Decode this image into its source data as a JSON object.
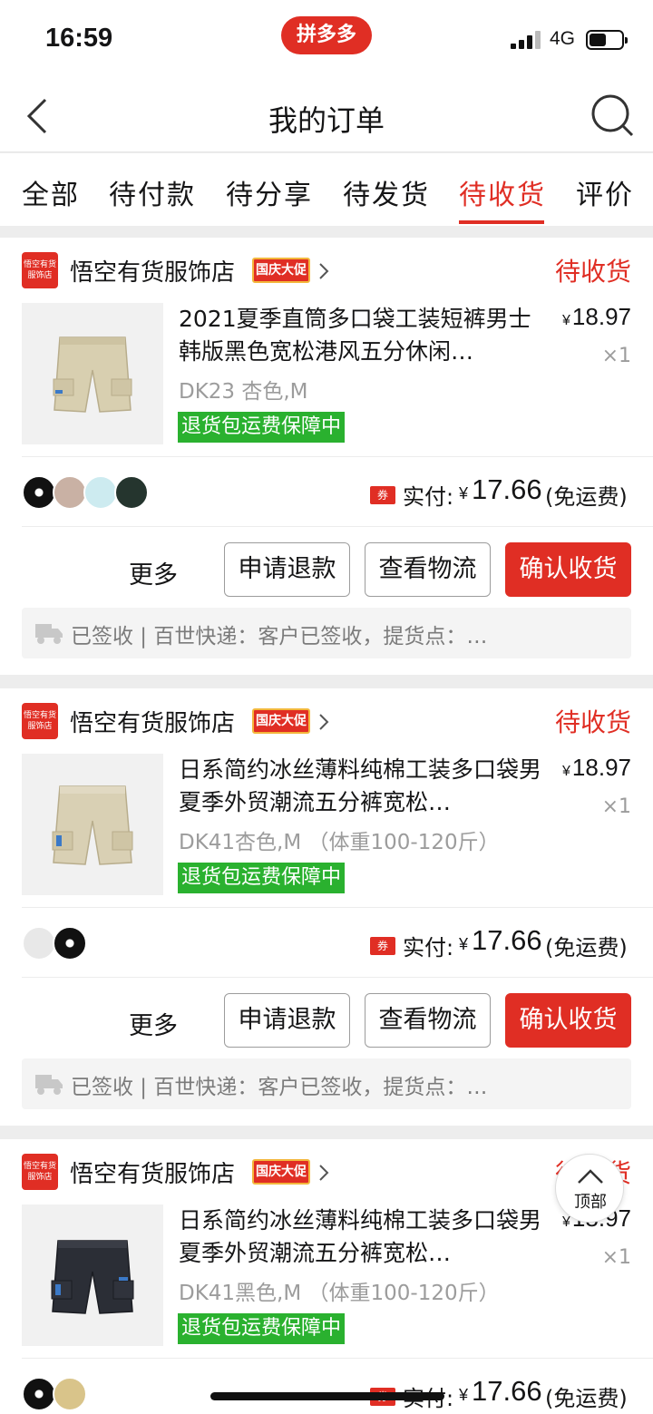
{
  "status_bar": {
    "time": "16:59",
    "app_logo": "拼多多",
    "network": "4G"
  },
  "nav": {
    "title": "我的订单"
  },
  "tabs": [
    {
      "label": "全部"
    },
    {
      "label": "待付款"
    },
    {
      "label": "待分享"
    },
    {
      "label": "待发货"
    },
    {
      "label": "待收货",
      "active": true
    },
    {
      "label": "评价"
    }
  ],
  "theme": {
    "accent": "#e02e24",
    "guarantee": "#2ab12f"
  },
  "orders": [
    {
      "store_logo": "悟空有货服饰店",
      "store_name": "悟空有货服饰店",
      "promo": "国庆大促",
      "status": "待收货",
      "title": "2021夏季直筒多口袋工装短裤男士韩版黑色宽松港风五分休闲…",
      "currency": "¥",
      "price": "18.97",
      "qty": "×1",
      "spec": "DK23 杏色,M",
      "guarantee": "退货包运费保障中",
      "coupon": "券",
      "paid_label": "实付:",
      "paid_amount": "17.66",
      "shipping": "(免运费)",
      "more": "更多",
      "refund": "申请退款",
      "logistics_btn": "查看物流",
      "confirm": "确认收货",
      "logistics": "已签收 | 百世快递：客户已签收，提货点：…",
      "product_color": "#d8cfb0"
    },
    {
      "store_logo": "悟空有货服饰店",
      "store_name": "悟空有货服饰店",
      "promo": "国庆大促",
      "status": "待收货",
      "title": "日系简约冰丝薄料纯棉工装多口袋男夏季外贸潮流五分裤宽松…",
      "currency": "¥",
      "price": "18.97",
      "qty": "×1",
      "spec": "DK41杏色,M （体重100-120斤）",
      "guarantee": "退货包运费保障中",
      "coupon": "券",
      "paid_label": "实付:",
      "paid_amount": "17.66",
      "shipping": "(免运费)",
      "more": "更多",
      "refund": "申请退款",
      "logistics_btn": "查看物流",
      "confirm": "确认收货",
      "logistics": "已签收 | 百世快递：客户已签收，提货点：…",
      "product_color": "#d9d0b4"
    },
    {
      "store_logo": "悟空有货服饰店",
      "store_name": "悟空有货服饰店",
      "promo": "国庆大促",
      "status": "待收货",
      "title": "日系简约冰丝薄料纯棉工装多口袋男夏季外贸潮流五分裤宽松…",
      "currency": "¥",
      "price": "18.97",
      "qty": "×1",
      "spec": "DK41黑色,M （体重100-120斤）",
      "guarantee": "退货包运费保障中",
      "coupon": "券",
      "paid_label": "实付:",
      "paid_amount": "17.66",
      "shipping": "(免运费)",
      "product_color": "#2b2e36"
    }
  ],
  "top_button": {
    "label": "顶部"
  }
}
